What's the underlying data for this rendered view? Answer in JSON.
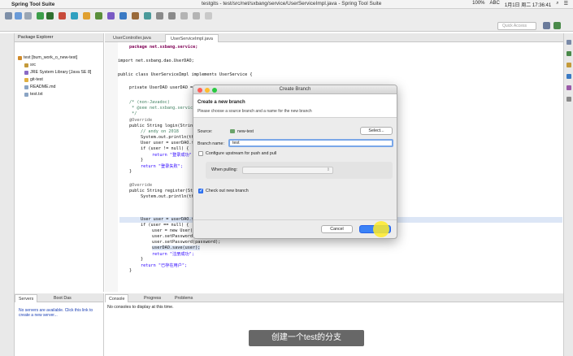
{
  "menubar": {
    "app_name": "Spring Tool Suite",
    "window_title": "testgits - test/src/net/sxbang/service/UserServiceImpl.java - Spring Tool Suite",
    "tray": {
      "battery": "100%",
      "input_method": "ABC",
      "datetime": "1月1日 周二 17:36:41"
    }
  },
  "toolbar": {
    "quick_access_placeholder": "Quick Access"
  },
  "explorer": {
    "tab_label": "Package Explorer",
    "items": [
      {
        "label": "test [bum_work_o_new-test]",
        "icon": "project-icon",
        "color": "#d08a2a"
      },
      {
        "label": "src",
        "icon": "source-folder-icon",
        "color": "#c49a3a"
      },
      {
        "label": "JRE System Library [Java SE 8]",
        "icon": "library-icon",
        "color": "#8a6ac4"
      },
      {
        "label": "git-test",
        "icon": "folder-icon",
        "color": "#e0b040"
      },
      {
        "label": "README.md",
        "icon": "file-icon",
        "color": "#8aa4c4"
      },
      {
        "label": "test.txt",
        "icon": "file-icon",
        "color": "#8aa4c4"
      }
    ]
  },
  "editor": {
    "tabs": [
      "UserController.java",
      "UserServiceImpl.java"
    ],
    "active_tab": 1,
    "lines": [
      "package net.sxbang.service;",
      "import net.sxbang.dao.UserDAO;",
      "public class UserServiceImpl implements UserService {",
      "private UserDAO userDAO = ...",
      "/* (non-Javadoc)",
      " * @see net.sxbang.servic",
      " */",
      "@Override",
      "public String login(String",
      "// andy on 2018",
      "System.out.println(th",
      "User user = userDAO.f",
      "if (user != null) {",
      "return \"登录成功\";",
      "}",
      "return \"登录失败\";",
      "}",
      "@Override",
      "public String register(St",
      "System.out.println(th",
      "User user = userDAO.f",
      "if (user == null) {",
      "user = new User()",
      "user.setPassword(username);",
      "user.setPassword(password);",
      "userDAO.save(user);",
      "return \"注册成功\";",
      "}",
      "return \"已存在用户\";",
      "}"
    ]
  },
  "servers_panel": {
    "tabs": [
      "Servers",
      "Boot Das"
    ],
    "message": "No servers are available. Click this link to create a new server..."
  },
  "console_panel": {
    "tabs": [
      "Console",
      "Progress",
      "Problems"
    ],
    "message": "No consoles to display at this time."
  },
  "dialog": {
    "title": "Create Branch",
    "heading": "Create a new branch",
    "subheading": "Please choose a source branch and a name for the new branch",
    "source_label": "Source:",
    "source_value": "new-test",
    "select_button": "Select...",
    "branch_name_label": "Branch name:",
    "branch_name_value": "test",
    "configure_upstream_label": "Configure upstream for push and pull",
    "configure_upstream_checked": false,
    "when_pulling_label": "When pulling:",
    "when_pulling_value": "",
    "checkout_label": "Check out new branch",
    "checkout_checked": true,
    "cancel_button": "Cancel",
    "finish_button": "Finish"
  },
  "subtitle": "创建一个test的分支",
  "colors": {
    "accent": "#3b82f6",
    "cursor_highlight": "#ffeb28",
    "keyword": "#7f0055",
    "string": "#2a00ff",
    "comment": "#3f7f5f"
  }
}
